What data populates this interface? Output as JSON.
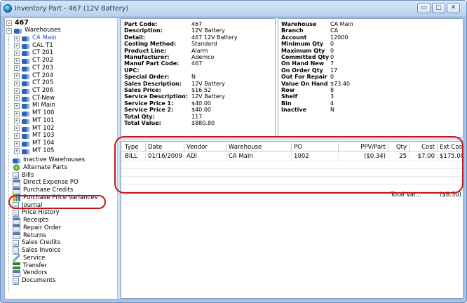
{
  "window": {
    "title": "Inventory Part - 467 (12V Battery)",
    "btn_min": "▭",
    "btn_max": "▢",
    "btn_close": "✕"
  },
  "tree": {
    "root": "467",
    "warehouses_label": "Warehouses",
    "warehouses": [
      "CA Main",
      "CAL T1",
      "CT 201",
      "CT 202",
      "CT 203",
      "CT 204",
      "CT 205",
      "CT 206",
      "CT-New",
      "MI Main",
      "MT 100",
      "MT 101",
      "MT 102",
      "MT 103",
      "MT 104",
      "MT 105"
    ],
    "items": [
      {
        "label": "Inactive Warehouses",
        "icon": "truck-icon"
      },
      {
        "label": "Alternate Parts",
        "icon": "gear-icon"
      },
      {
        "label": "Bills",
        "icon": "document-icon"
      },
      {
        "label": "Direct Expense PO",
        "icon": "list-icon"
      },
      {
        "label": "Purchase Credits",
        "icon": "list-icon"
      },
      {
        "label": "Purchase Price Variances",
        "icon": "bars-icon"
      },
      {
        "label": "Journal",
        "icon": "document-icon"
      },
      {
        "label": "Price History",
        "icon": "document-icon"
      },
      {
        "label": "Receipts",
        "icon": "list-icon"
      },
      {
        "label": "Repair Order",
        "icon": "list-icon"
      },
      {
        "label": "Returns",
        "icon": "list-icon"
      },
      {
        "label": "Sales Credits",
        "icon": "document-icon"
      },
      {
        "label": "Sales Invoice",
        "icon": "document-icon"
      },
      {
        "label": "Service",
        "icon": "wrench-icon"
      },
      {
        "label": "Transfer",
        "icon": "arrows-icon"
      },
      {
        "label": "Vendors",
        "icon": "list-icon"
      },
      {
        "label": "Documents",
        "icon": "document-icon"
      }
    ]
  },
  "part": {
    "fields": [
      {
        "k": "Part Code:",
        "v": "467"
      },
      {
        "k": "Description:",
        "v": "12V Battery"
      },
      {
        "k": "Detail:",
        "v": "467 12V Battery"
      },
      {
        "k": "Costing Method:",
        "v": "Standard"
      },
      {
        "k": "Product Line:",
        "v": "Alarm"
      },
      {
        "k": "Manufacturer:",
        "v": "Ademco"
      },
      {
        "k": "Manuf Part Code:",
        "v": "467"
      },
      {
        "k": "UPC:",
        "v": ""
      },
      {
        "k": "Special Order:",
        "v": "N"
      },
      {
        "k": "Sales Description:",
        "v": "12V Battery"
      },
      {
        "k": "Sales Price:",
        "v": "$16.52"
      },
      {
        "k": "Service Description:",
        "v": "12V Battery"
      },
      {
        "k": "Service Price 1:",
        "v": "$40.00"
      },
      {
        "k": "Service Price 2:",
        "v": "$40.00"
      },
      {
        "k": "Total Qty:",
        "v": "117"
      },
      {
        "k": "Total Value:",
        "v": "$880.80"
      }
    ]
  },
  "warehouse": {
    "fields": [
      {
        "k": "Warehouse",
        "v": "CA Main"
      },
      {
        "k": "Branch",
        "v": "CA"
      },
      {
        "k": "Account",
        "v": "12000"
      },
      {
        "k": "Minimum Qty",
        "v": "0"
      },
      {
        "k": "Maximum Qty",
        "v": "0"
      },
      {
        "k": "Committed Qty",
        "v": "0"
      },
      {
        "k": "On Hand New",
        "v": "7"
      },
      {
        "k": "On Order Qty",
        "v": "17"
      },
      {
        "k": "Out For Repair",
        "v": "0"
      },
      {
        "k": "Value On Hand",
        "v": "$73.40"
      },
      {
        "k": "Row",
        "v": "8"
      },
      {
        "k": "Shelf",
        "v": "3"
      },
      {
        "k": "Bin",
        "v": "4"
      },
      {
        "k": "Inactive",
        "v": "N"
      }
    ]
  },
  "grid": {
    "columns": [
      "Type",
      "Date",
      "Vendor",
      "Warehouse",
      "PO",
      "PPV/Part",
      "Qty",
      "Cost",
      "Ext Cost"
    ],
    "rows": [
      [
        "BILL",
        "01/16/2009",
        "ADI",
        "CA Main",
        "1002",
        "($0.34)",
        "25",
        "$7.00",
        "$175.00"
      ]
    ],
    "total_label": "Total Var...",
    "total_value": "($8.50)"
  },
  "colors": {
    "highlight": "#c01818",
    "selected_text": "#1f4fd6",
    "chrome": "#a9c3e4"
  }
}
